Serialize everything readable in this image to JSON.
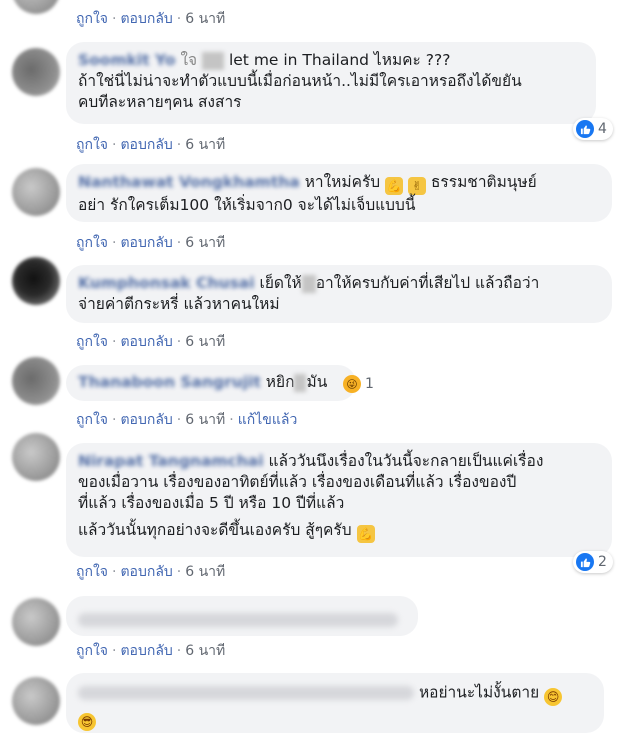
{
  "actions": {
    "like": "ถูกใจ",
    "reply": "ตอบกลับ",
    "edited": "แก้ไขแล้ว"
  },
  "comments": [
    {
      "time": "6 นาที"
    },
    {
      "name": "Soomkit Yo",
      "text1": "ใจ",
      "text1b": "ถ้าป",
      "text1c": "let me in Thailand ไหมคะ ???",
      "text2": "ถ้าใช่นี่ไม่น่าจะทำตัวแบบนี้เมื่อก่อนหน้า..ไม่มีใครเอาหรอถึงได้ขยัน",
      "text3": "คบทีละหลายๆคน สงสาร",
      "time": "6 นาที",
      "reaction_count": "4"
    },
    {
      "name": "Nanthawat Vongkhamtha",
      "text1": "หาใหม่ครับ",
      "text1b": "ธรรมชาติมนุษย์",
      "text2": "อย่า รักใครเต็ม100 ให้เริ่มจาก0 จะได้ไม่เจ็บแบบนี้",
      "time": "6 นาที"
    },
    {
      "name": "Kumphonsak Chusai",
      "text1": "เย็ดให้",
      "text1b": "อาให้ครบกับค่าที่เสียไป แล้วถือว่า",
      "text2": "จ่ายค่าตีกระหรี่ แล้วหาคนใหม่",
      "time": "6 นาที"
    },
    {
      "name": "Thanaboon Sangrujit",
      "text1": "หยิก",
      "text1b": "มัน",
      "time": "6 นาที",
      "reaction_count": "1"
    },
    {
      "name": "Nirapat Tangnamchai",
      "text1": "แล้ววันนึงเรื่องในวันนี้จะกลายเป็นแค่เรื่อง",
      "text2": "ของเมื่อวาน เรื่องของอาทิตย์ที่แล้ว เรื่องของเดือนที่แล้ว เรื่องของปี",
      "text3": "ที่แล้ว เรื่องของเมื่อ 5 ปี หรือ 10 ปีที่แล้ว",
      "text4": "แล้ววันนั้นทุกอย่างจะดีขึ้นเองครับ สู้ๆครับ",
      "time": "6 นาที",
      "reaction_count": "2"
    },
    {
      "time": "6 นาที"
    },
    {
      "text1": "หอย่านะไม่งั้นตาย"
    }
  ],
  "icons": {
    "like": "like-icon",
    "haha": "haha-icon",
    "flex": "flexed-biceps-emoji",
    "peace": "victory-hand-emoji",
    "grin": "tongue-wink-emoji",
    "smile": "smiling-emoji",
    "cool": "sunglasses-emoji"
  }
}
